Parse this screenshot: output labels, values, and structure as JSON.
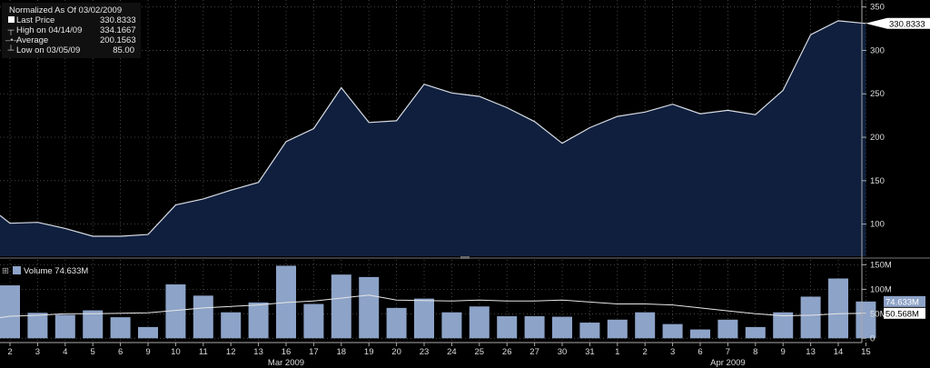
{
  "legend": {
    "title": "Normalized As Of 03/02/2009",
    "rows": [
      {
        "icon": "square-marker-icon",
        "label": "Last Price",
        "value": "330.8333"
      },
      {
        "icon": "high-marker-icon",
        "label": "High on 04/14/09",
        "value": "334.1667"
      },
      {
        "icon": "average-marker-icon",
        "label": "Average",
        "value": "200.1563"
      },
      {
        "icon": "low-marker-icon",
        "label": "Low on 03/05/09",
        "value": "85.00"
      }
    ]
  },
  "volume_legend": {
    "label": "Volume",
    "value": "74.633M"
  },
  "colors": {
    "price_line": "#d9dde6",
    "price_fill": "#0f1f3d",
    "volume_bar": "#8da3c8",
    "volume_avg": "#e6e6e6",
    "grid": "#555555",
    "background": "#000000"
  },
  "chart_data": [
    {
      "type": "area",
      "x_tick_labels": [
        "2",
        "3",
        "4",
        "5",
        "6",
        "9",
        "10",
        "11",
        "12",
        "13",
        "16",
        "17",
        "18",
        "19",
        "20",
        "23",
        "24",
        "25",
        "26",
        "27",
        "30",
        "31",
        "1",
        "2",
        "3",
        "6",
        "7",
        "8",
        "9",
        "13",
        "14",
        "15"
      ],
      "month_labels": [
        {
          "label": "Mar 2009",
          "index": 10
        },
        {
          "label": "Apr 2009",
          "index": 26
        }
      ],
      "values": [
        110,
        101,
        102,
        95,
        86,
        86,
        88,
        122,
        129,
        139,
        148,
        195,
        210,
        257,
        217,
        219,
        261,
        251,
        247,
        234,
        218,
        193,
        211,
        224,
        229,
        238,
        227,
        231,
        226,
        254,
        318,
        334,
        331
      ],
      "yticks": [
        100,
        150,
        200,
        250,
        300,
        350
      ],
      "ylim": [
        63,
        358
      ],
      "last_value_label": "330.8333"
    },
    {
      "type": "bar",
      "values": [
        108,
        52,
        48,
        57,
        43,
        23,
        110,
        87,
        53,
        73,
        148,
        70,
        130,
        125,
        62,
        81,
        53,
        65,
        45,
        45,
        44,
        32,
        38,
        53,
        29,
        18,
        38,
        23,
        53,
        85,
        122,
        75
      ],
      "moving_average": [
        42,
        45,
        47,
        50,
        50,
        51,
        52,
        57,
        62,
        65,
        68,
        73,
        76,
        82,
        88,
        78,
        77,
        76,
        78,
        76,
        76,
        78,
        74,
        70,
        70,
        68,
        62,
        56,
        50,
        46,
        47,
        50,
        51
      ],
      "yticks": [
        0,
        50,
        100,
        150
      ],
      "ytick_labels": [
        "0",
        "50M",
        "100M",
        "150M"
      ],
      "ylim": [
        -5,
        160
      ],
      "value_labels": [
        "74.633M",
        "50.568M"
      ]
    }
  ]
}
